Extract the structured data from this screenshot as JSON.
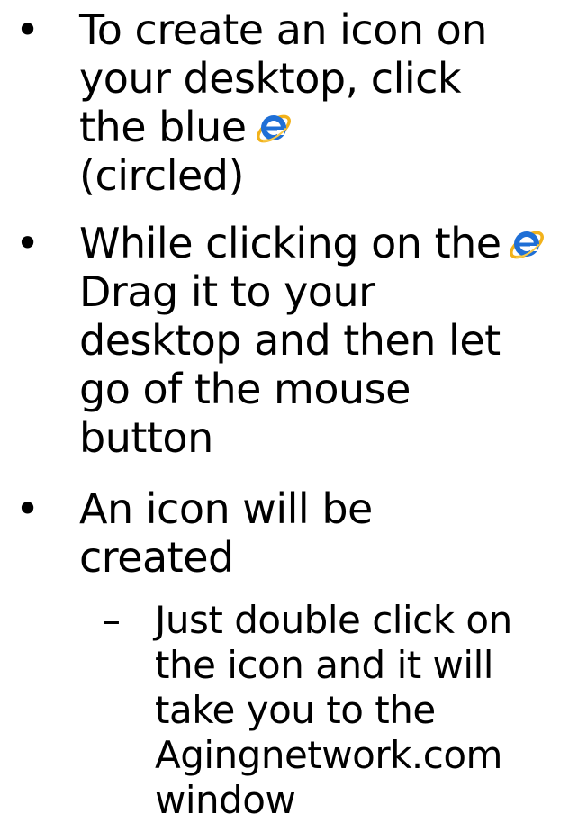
{
  "bullets": [
    {
      "marker": "•",
      "lines": [
        "To create an icon on",
        "your desktop, click",
        "the blue",
        "(circled)"
      ],
      "icon": "internet-explorer-icon"
    },
    {
      "marker": "•",
      "lines": [
        "While clicking on the",
        "Drag it to your",
        "desktop and then let",
        "go of the mouse",
        "button"
      ],
      "icon": "internet-explorer-icon"
    },
    {
      "marker": "•",
      "lines": [
        "An icon will be",
        "created"
      ]
    }
  ],
  "sub_bullet": {
    "marker": "–",
    "lines": [
      "Just double click on",
      "the icon and it will",
      "take you to the",
      "Agingnetwork.com",
      "window"
    ]
  },
  "colors": {
    "ie_blue": "#1f6fd6",
    "ie_ring": "#f2b21b",
    "text": "#000000",
    "background": "#ffffff"
  }
}
